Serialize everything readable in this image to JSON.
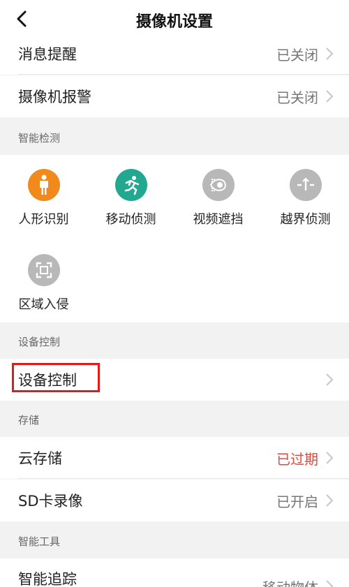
{
  "header": {
    "title": "摄像机设置",
    "back_icon": "chevron-left-icon"
  },
  "rows_top": [
    {
      "label": "消息提醒",
      "value": "已关闭"
    },
    {
      "label": "摄像机报警",
      "value": "已关闭"
    }
  ],
  "sections": {
    "smart_detect": "智能检测",
    "device_control": "设备控制",
    "storage": "存储",
    "smart_tools": "智能工具"
  },
  "smart_detect_items": [
    {
      "label": "人形识别",
      "icon": "person-icon",
      "color": "#f08a1c"
    },
    {
      "label": "移动侦测",
      "icon": "running-icon",
      "color": "#22a890"
    },
    {
      "label": "视频遮挡",
      "icon": "occlusion-icon",
      "color": "#b8b8b8"
    },
    {
      "label": "越界侦测",
      "icon": "boundary-icon",
      "color": "#b8b8b8"
    },
    {
      "label": "区域入侵",
      "icon": "region-icon",
      "color": "#b8b8b8"
    }
  ],
  "device_control_row": {
    "label": "设备控制"
  },
  "storage_rows": [
    {
      "label": "云存储",
      "value": "已过期",
      "value_color": "#e5483a"
    },
    {
      "label": "SD卡录像",
      "value": "已开启"
    }
  ],
  "tools_rows": [
    {
      "label": "智能追踪",
      "value": "移动物体"
    }
  ]
}
